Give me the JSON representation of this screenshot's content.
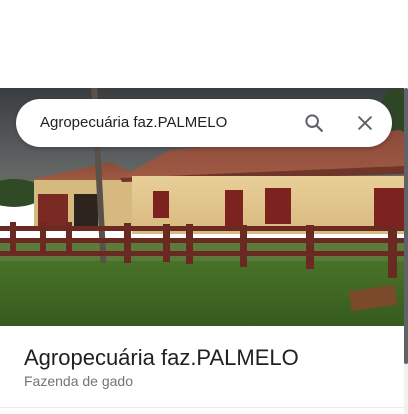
{
  "search": {
    "query": "Agropecuária faz.PALMELO"
  },
  "place": {
    "name": "Agropecuária faz.PALMELO",
    "category": "Fazenda de gado"
  },
  "icons": {
    "search": "search-icon",
    "close": "close-icon"
  },
  "colors": {
    "title_text": "#202124",
    "subtitle_text": "#70757a",
    "icon": "#5f6368"
  }
}
